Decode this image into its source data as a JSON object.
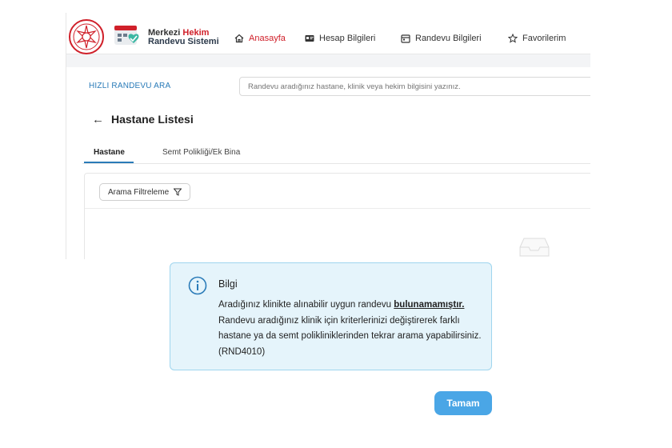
{
  "header": {
    "logo": {
      "line1_a": "Merkezi",
      "line1_b": "Hekim",
      "line2": "Randevu Sistemi"
    },
    "nav": [
      {
        "label": "Anasayfa",
        "icon": "home-icon",
        "active": true
      },
      {
        "label": "Hesap Bilgileri",
        "icon": "id-card-icon",
        "active": false
      },
      {
        "label": "Randevu Bilgileri",
        "icon": "calendar-icon",
        "active": false
      },
      {
        "label": "Favorilerim",
        "icon": "star-icon",
        "active": false
      }
    ]
  },
  "quick_search": {
    "label": "HIZLI RANDEVU ARA",
    "placeholder": "Randevu aradığınız hastane, klinik veya hekim bilgisini yazınız."
  },
  "page": {
    "back_icon": "arrow-left-icon",
    "title": "Hastane Listesi",
    "tabs": [
      {
        "label": "Hastane",
        "active": true
      },
      {
        "label": "Semt Polikliği/Ek Bina",
        "active": false
      }
    ],
    "filter_button": "Arama Filtreleme"
  },
  "dialog": {
    "icon": "info-circle-icon",
    "title": "Bilgi",
    "message_part1": "Aradığınız klinikte alınabilir uygun randevu",
    "message_bold": "bulunamamıştır.",
    "message_part2": "Randevu aradığınız klinik için kriterlerinizi değiştirerek farklı hastane ya da semt polikliniklerinden tekrar arama yapabilirsiniz. (RND4010)",
    "ok_button": "Tamam"
  },
  "colors": {
    "brand_red": "#d0202a",
    "link_blue": "#2a7bb8",
    "info_bg": "#e5f4fb",
    "info_border": "#9fd5ee",
    "ok_button": "#4aa6e6"
  }
}
